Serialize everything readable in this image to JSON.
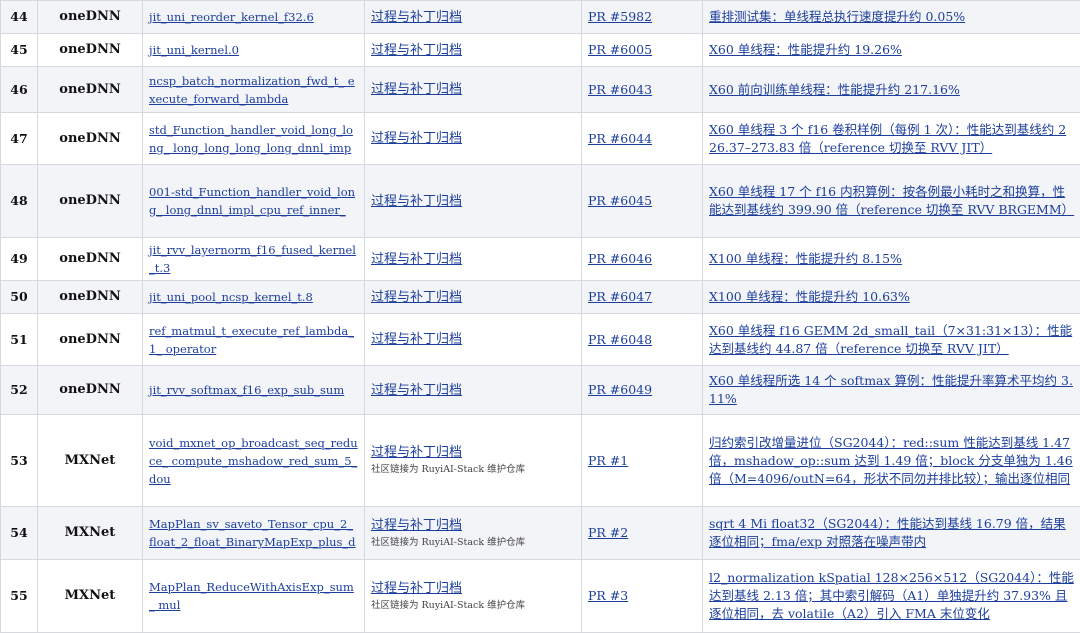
{
  "rows": [
    {
      "no": "44",
      "framework": "oneDNN",
      "function": "jit_uni_reorder_kernel_f32.6",
      "category": "过程与补丁归档",
      "note": "",
      "pr": "PR #5982",
      "result": "重排测试集：单线程总执行速度提升约 0.05%"
    },
    {
      "no": "45",
      "framework": "oneDNN",
      "function": "jit_uni_kernel.0",
      "category": "过程与补丁归档",
      "note": "",
      "pr": "PR #6005",
      "result": "X60 单线程：性能提升约 19.26%"
    },
    {
      "no": "46",
      "framework": "oneDNN",
      "function": "ncsp_batch_normalization_fwd_t_ execute_forward_lambda",
      "category": "过程与补丁归档",
      "note": "",
      "pr": "PR #6043",
      "result": "X60 前向训练单线程：性能提升约 217.16%"
    },
    {
      "no": "47",
      "framework": "oneDNN",
      "function": "std_Function_handler_void_long_long_ long_long_long_long_dnnl_imp",
      "category": "过程与补丁归档",
      "note": "",
      "pr": "PR #6044",
      "result": "X60 单线程 3 个 f16 卷积样例（每例 1 次）：性能达到基线约 226.37–273.83 倍（reference 切换至 RVV JIT）"
    },
    {
      "no": "48",
      "framework": "oneDNN",
      "function": "001-std_Function_handler_void_long_ long_dnnl_impl_cpu_ref_inner_",
      "category": "过程与补丁归档",
      "note": "",
      "pr": "PR #6045",
      "result": "X60 单线程 17 个 f16 内积算例：按各例最小耗时之和换算，性能达到基线约 399.90 倍（reference 切换至 RVV BRGEMM）"
    },
    {
      "no": "49",
      "framework": "oneDNN",
      "function": "jit_rvv_layernorm_f16_fused_kernel_t.3",
      "category": "过程与补丁归档",
      "note": "",
      "pr": "PR #6046",
      "result": "X100 单线程：性能提升约 8.15%"
    },
    {
      "no": "50",
      "framework": "oneDNN",
      "function": "jit_uni_pool_ncsp_kernel_t.8",
      "category": "过程与补丁归档",
      "note": "",
      "pr": "PR #6047",
      "result": "X100 单线程：性能提升约 10.63%"
    },
    {
      "no": "51",
      "framework": "oneDNN",
      "function": "ref_matmul_t_execute_ref_lambda_1_ operator",
      "category": "过程与补丁归档",
      "note": "",
      "pr": "PR #6048",
      "result": "X60 单线程 f16 GEMM 2d_small_tail（7×31:31×13）：性能达到基线约 44.87 倍（reference 切换至 RVV JIT）"
    },
    {
      "no": "52",
      "framework": "oneDNN",
      "function": "jit_rvv_softmax_f16_exp_sub_sum",
      "category": "过程与补丁归档",
      "note": "",
      "pr": "PR #6049",
      "result": "X60 单线程所选 14 个 softmax 算例：性能提升率算术平均约 3.11%"
    },
    {
      "no": "53",
      "framework": "MXNet",
      "function": "void_mxnet_op_broadcast_seq_reduce_ compute_mshadow_red_sum_5_dou",
      "category": "过程与补丁归档",
      "note": "社区链接为 RuyiAI-Stack 维护仓库",
      "pr": "PR #1",
      "result": "归约索引改增量进位（SG2044）：red::sum 性能达到基线 1.47 倍，mshadow_op::sum 达到 1.49 倍；block 分支单独为 1.46 倍（M=4096/outN=64，形状不同勿并排比较）；输出逐位相同"
    },
    {
      "no": "54",
      "framework": "MXNet",
      "function": "MapPlan_sv_saveto_Tensor_cpu_2_ float_2_float_BinaryMapExp_plus_d",
      "category": "过程与补丁归档",
      "note": "社区链接为 RuyiAI-Stack 维护仓库",
      "pr": "PR #2",
      "result": "sqrt 4 Mi float32（SG2044）：性能达到基线 16.79 倍，结果逐位相同；fma/exp 对照落在噪声带内"
    },
    {
      "no": "55",
      "framework": "MXNet",
      "function": "MapPlan_ReduceWithAxisExp_sum_ mul",
      "category": "过程与补丁归档",
      "note": "社区链接为 RuyiAI-Stack 维护仓库",
      "pr": "PR #3",
      "result": "l2_normalization kSpatial 128×256×512（SG2044）：性能达到基线 2.13 倍；其中索引解码（A1）单独提升约 37.93% 且逐位相同，去 volatile（A2）引入 FMA 末位变化"
    }
  ]
}
